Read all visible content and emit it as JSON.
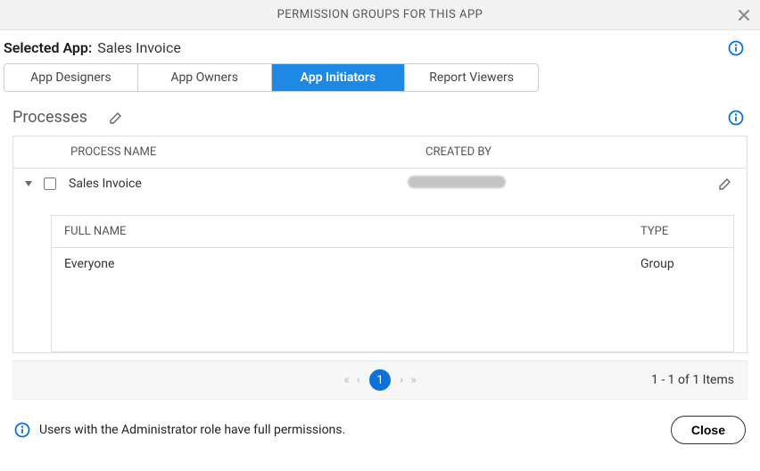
{
  "header": {
    "title": "PERMISSION GROUPS FOR THIS APP"
  },
  "selected": {
    "label": "Selected App:",
    "app": "Sales Invoice"
  },
  "tabs": [
    {
      "label": "App Designers",
      "active": false
    },
    {
      "label": "App Owners",
      "active": false
    },
    {
      "label": "App Initiators",
      "active": true
    },
    {
      "label": "Report Viewers",
      "active": false
    }
  ],
  "processes": {
    "heading": "Processes",
    "columns": {
      "name": "PROCESS NAME",
      "created": "CREATED BY"
    },
    "rows": [
      {
        "name": "Sales Invoice",
        "created_by": ""
      }
    ],
    "sub": {
      "columns": {
        "fullname": "FULL NAME",
        "type": "TYPE"
      },
      "rows": [
        {
          "fullname": "Everyone",
          "type": "Group"
        }
      ]
    }
  },
  "pager": {
    "page": "1",
    "count_text": "1 - 1 of 1 Items"
  },
  "footer": {
    "message": "Users with the Administrator role have full permissions.",
    "close": "Close"
  }
}
